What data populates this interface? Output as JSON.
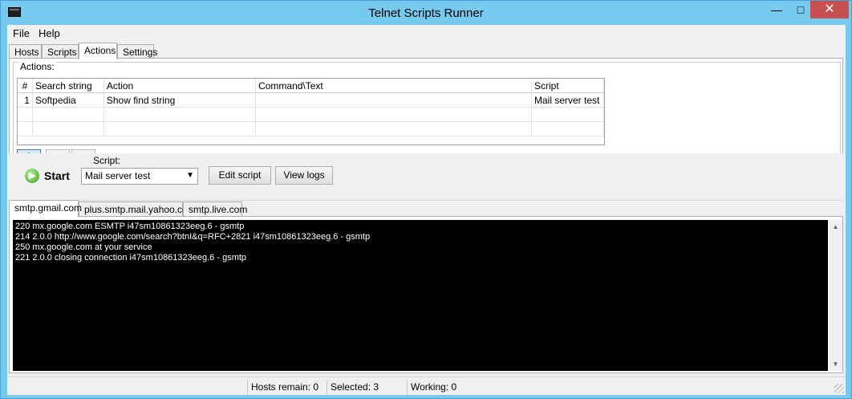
{
  "window": {
    "title": "Telnet Scripts Runner",
    "minimize_glyph": "—",
    "maximize_glyph": "□",
    "close_glyph": "✕"
  },
  "menu": {
    "file": "File",
    "help": "Help"
  },
  "main_tabs": [
    "Hosts",
    "Scripts",
    "Actions",
    "Settings"
  ],
  "actions": {
    "group_label": "Actions:",
    "columns": [
      "#",
      "Search string",
      "Action",
      "Command\\Text",
      "Script"
    ],
    "rows": [
      {
        "num": "1",
        "search": "Softpedia",
        "action": "Show find string",
        "command": "",
        "script": "Mail server test"
      }
    ],
    "toolbar": {
      "add_icon": "add-icon",
      "delete_icon": "delete-icon",
      "edit_icon": "edit-icon"
    }
  },
  "controls": {
    "start_label": "Start",
    "script_label": "Script:",
    "script_value": "Mail server test",
    "edit_script": "Edit script",
    "view_logs": "View logs"
  },
  "host_tabs": [
    "smtp.gmail.com",
    "plus.smtp.mail.yahoo.com",
    "smtp.live.com"
  ],
  "log_lines": [
    "220 mx.google.com ESMTP i47sm10861323eeg.6 - gsmtp",
    "214 2.0.0 http://www.google.com/search?btnI&q=RFC+2821 i47sm10861323eeg.6 - gsmtp",
    "250 mx.google.com at your service",
    "221 2.0.0 closing connection i47sm10861323eeg.6 - gsmtp"
  ],
  "status": {
    "hosts_remain": "Hosts remain: 0",
    "selected": "Selected: 3",
    "working": "Working: 0"
  },
  "colors": {
    "titlebar": "#78c9ee",
    "close_button": "#c75050",
    "log_bg": "#000000",
    "log_fg": "#ffffff"
  }
}
